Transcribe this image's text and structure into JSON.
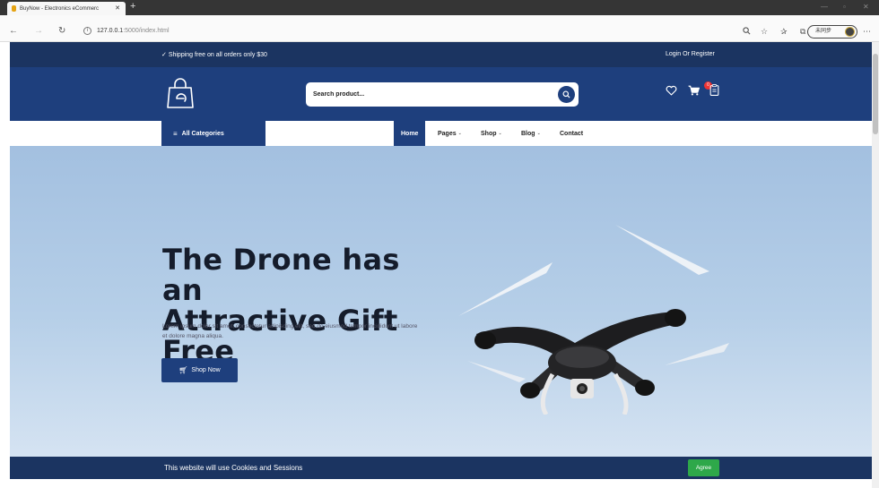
{
  "browser": {
    "tab_title": "BuyNow - Electronics eCommerc",
    "tab_close": "✕",
    "new_tab": "+",
    "url_host": "127.0.0.1",
    "url_rest": ":5000/index.html",
    "sync_label": "未同步",
    "window_controls": [
      "—",
      "▫",
      "✕"
    ],
    "right_icons": [
      "search-icon",
      "star-icon",
      "favorites-icon",
      "collections-icon",
      "more-icon"
    ]
  },
  "topbar": {
    "shipping": "Shipping free on all orders only $30",
    "login": "Login Or Register"
  },
  "header": {
    "search_placeholder": "Search product...",
    "cart_count": "0"
  },
  "nav": {
    "all_categories": "All Categories",
    "items": [
      {
        "label": "Home",
        "active": true
      },
      {
        "label": "Pages",
        "dropdown": true
      },
      {
        "label": "Shop",
        "dropdown": true
      },
      {
        "label": "Blog",
        "dropdown": true
      },
      {
        "label": "Contact"
      }
    ]
  },
  "hero": {
    "title_line1": "The Drone has an",
    "title_line2": "Attractive Gift Free",
    "text": "Lorem ipsum dolor sit amet, consectetur adipiscing elit, sed do eiusmod tempor incididunt ut labore et dolore magna aliqua.",
    "button": "Shop Now"
  },
  "cookie": {
    "message": "This website will use Cookies and Sessions",
    "agree": "Agree"
  },
  "colors": {
    "primary": "#1e3f7d",
    "topbar": "#1b3461",
    "accent_green": "#2ea84a",
    "badge": "#e33333"
  }
}
